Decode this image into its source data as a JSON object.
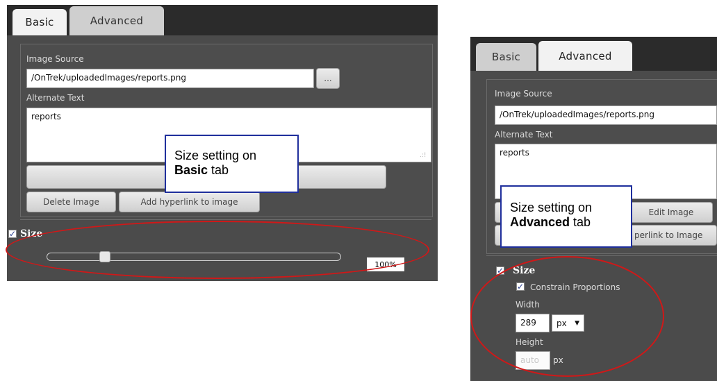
{
  "left": {
    "tabs": [
      "Basic",
      "Advanced"
    ],
    "image_source_label": "Image Source",
    "image_source_value": "/OnTrek/uploadedImages/reports.png",
    "browse_label": "...",
    "alt_text_label": "Alternate Text",
    "alt_text_value": "reports",
    "delete_button": "Delete Image",
    "hyperlink_button": "Add hyperlink to image",
    "size_label": "Size",
    "size_percent": "100%",
    "slider_value_fraction": 0.19
  },
  "right": {
    "tabs": [
      "Basic",
      "Advanced"
    ],
    "image_source_label": "Image Source",
    "image_source_value": "/OnTrek/uploadedImages/reports.png",
    "alt_text_label": "Alternate Text",
    "alt_text_value": "reports",
    "edit_button": "Edit Image",
    "hyperlink_button_partial": "perlink to Image",
    "size_label": "Size",
    "constrain_label": "Constrain Proportions",
    "width_label": "Width",
    "width_value": "289",
    "width_unit": "px",
    "height_label": "Height",
    "height_placeholder": "auto",
    "height_unit": "px"
  },
  "callouts": {
    "basic_line1": "Size setting on",
    "basic_bold": "Basic",
    "basic_tail": " tab",
    "advanced_line1": "Size setting on",
    "advanced_bold": "Advanced",
    "advanced_tail": " tab"
  },
  "colors": {
    "callout_border": "#1f2f9c",
    "highlight_ellipse": "#d01818",
    "panel_bg": "#4b4b4b"
  }
}
